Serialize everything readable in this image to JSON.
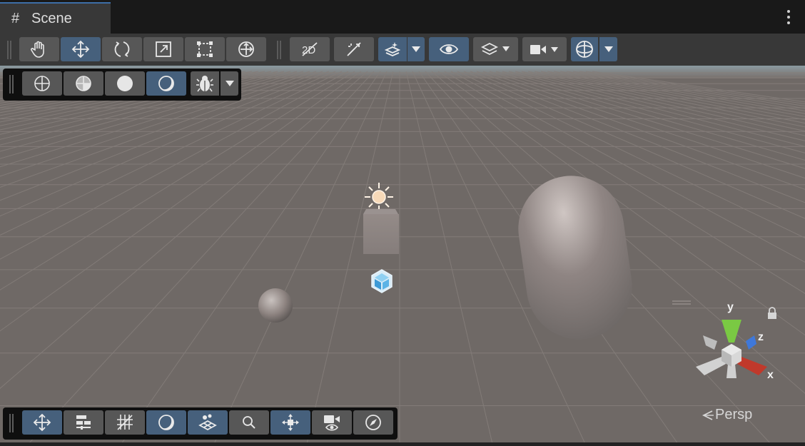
{
  "window": {
    "tab_icon": "hash-icon",
    "tab_title": "Scene",
    "menu_icon": "kebab-menu-icon"
  },
  "toolbar": {
    "transform_tools": [
      {
        "name": "hand-tool",
        "icon": "hand-icon",
        "active": false
      },
      {
        "name": "move-tool",
        "icon": "move-icon",
        "active": true
      },
      {
        "name": "rotate-tool",
        "icon": "rotate-icon",
        "active": false
      },
      {
        "name": "scale-tool",
        "icon": "scale-icon",
        "active": false
      },
      {
        "name": "rect-tool",
        "icon": "rect-icon",
        "active": false
      },
      {
        "name": "transform-tool",
        "icon": "transform-icon",
        "active": false
      }
    ],
    "view_options": [
      {
        "name": "2d-toggle",
        "icon": "2d-icon",
        "active": false
      },
      {
        "name": "lighting-toggle",
        "icon": "lighting-off-icon",
        "active": false
      },
      {
        "name": "effects-toggle",
        "icon": "effects-icon",
        "active": true,
        "dropdown": true
      },
      {
        "name": "visibility-toggle",
        "icon": "eye-icon",
        "active": true
      },
      {
        "name": "layers-dropdown",
        "icon": "layers-icon",
        "active": false,
        "dropdown": true
      },
      {
        "name": "camera-dropdown",
        "icon": "camera-icon",
        "active": false,
        "dropdown": true
      },
      {
        "name": "gizmos-toggle",
        "icon": "gizmo-icon",
        "active": true,
        "dropdown": true
      }
    ]
  },
  "draw_modes": [
    {
      "name": "wireframe-mode",
      "icon": "wireframe-icon",
      "active": false
    },
    {
      "name": "shaded-wireframe-mode",
      "icon": "shaded-wireframe-icon",
      "active": false
    },
    {
      "name": "shaded-mode",
      "icon": "shaded-icon",
      "active": false
    },
    {
      "name": "unlit-mode",
      "icon": "unlit-icon",
      "active": true
    },
    {
      "name": "debug-mode",
      "icon": "bug-icon",
      "active": false,
      "dropdown": true
    }
  ],
  "bottom_tools": [
    {
      "name": "tool-settings",
      "icon": "move-icon",
      "active": true
    },
    {
      "name": "snap-settings",
      "icon": "sliders-icon",
      "active": false
    },
    {
      "name": "grid-settings",
      "icon": "grid-icon",
      "active": false
    },
    {
      "name": "render-mode",
      "icon": "unlit-icon",
      "active": true
    },
    {
      "name": "orientation",
      "icon": "plane-icon",
      "active": true
    },
    {
      "name": "search",
      "icon": "search-icon",
      "active": false
    },
    {
      "name": "pivot-tool",
      "icon": "pivot-icon",
      "active": true
    },
    {
      "name": "camera-overlay",
      "icon": "camera-eye-icon",
      "active": false
    },
    {
      "name": "navigation",
      "icon": "compass-icon",
      "active": false
    }
  ],
  "gizmo": {
    "y_label": "y",
    "z_label": "z",
    "x_label": "x",
    "y_color": "#7ac943",
    "z_color": "#3f78d9",
    "x_color": "#c0392b",
    "lock_icon": "lock-icon"
  },
  "view_label": "Persp",
  "scene_objects": [
    {
      "name": "light-icon",
      "type": "directional-light"
    },
    {
      "name": "cube",
      "type": "mesh"
    },
    {
      "name": "package-icon",
      "type": "prefab"
    },
    {
      "name": "sphere",
      "type": "mesh"
    },
    {
      "name": "capsule",
      "type": "mesh"
    }
  ]
}
